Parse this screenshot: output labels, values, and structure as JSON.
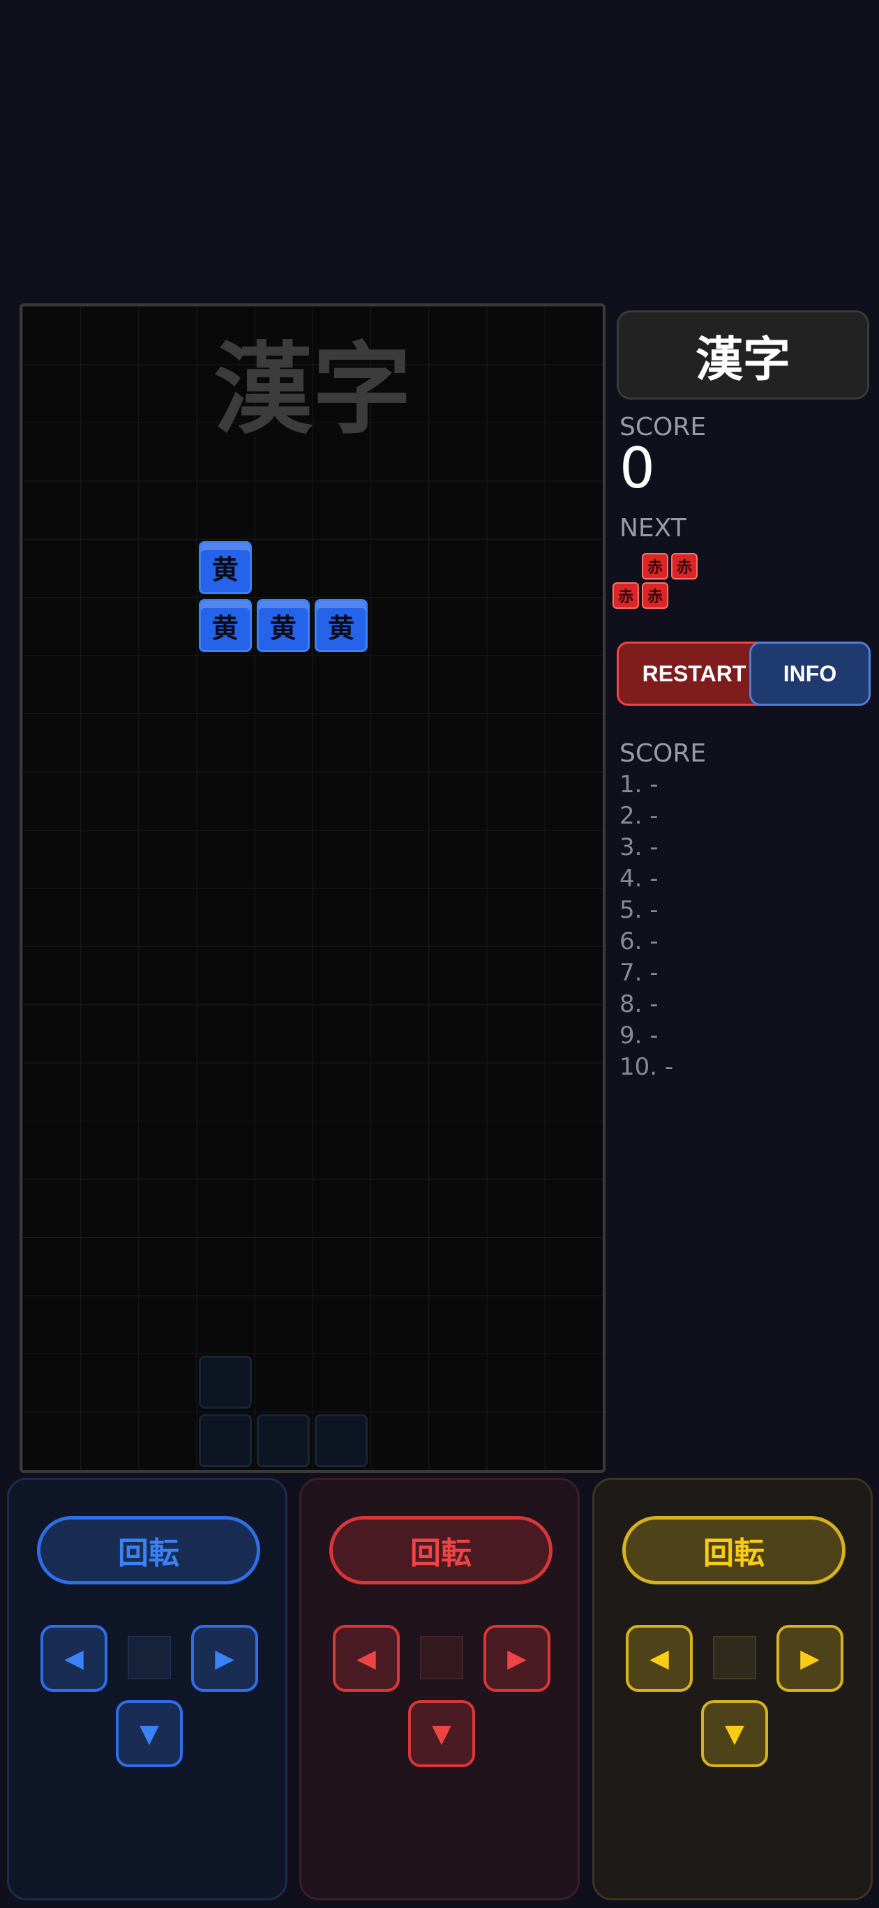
{
  "board": {
    "title": "漢字",
    "active_piece": {
      "color": "#2563eb",
      "cells": [
        {
          "col": 3,
          "row": 4,
          "kanji": "黄"
        },
        {
          "col": 3,
          "row": 5,
          "kanji": "黄"
        },
        {
          "col": 4,
          "row": 5,
          "kanji": "黄"
        },
        {
          "col": 5,
          "row": 5,
          "kanji": "黄"
        }
      ]
    },
    "ghost_cells": [
      {
        "col": 3,
        "row": 18
      },
      {
        "col": 3,
        "row": 19
      },
      {
        "col": 4,
        "row": 19
      },
      {
        "col": 5,
        "row": 19
      }
    ]
  },
  "side": {
    "title": "漢字",
    "score_label": "SCORE",
    "score_value": "0",
    "next_label": "NEXT",
    "next_piece": [
      "赤",
      "赤",
      "赤",
      "赤"
    ],
    "restart_label": "RESTART",
    "info_label": "INFO",
    "ranking_label": "SCORE",
    "ranking": [
      "1. -",
      "2. -",
      "3. -",
      "4. -",
      "5. -",
      "6. -",
      "7. -",
      "8. -",
      "9. -",
      "10. -"
    ]
  },
  "controls": {
    "blue": {
      "rotate_label": "回転",
      "left": "◀",
      "right": "▶",
      "down": "▼",
      "color": "#3b82f6"
    },
    "red": {
      "rotate_label": "回転",
      "left": "◀",
      "right": "▶",
      "down": "▼",
      "color": "#ef4444"
    },
    "yellow": {
      "rotate_label": "回転",
      "left": "◀",
      "right": "▶",
      "down": "▼",
      "color": "#facc15"
    }
  }
}
